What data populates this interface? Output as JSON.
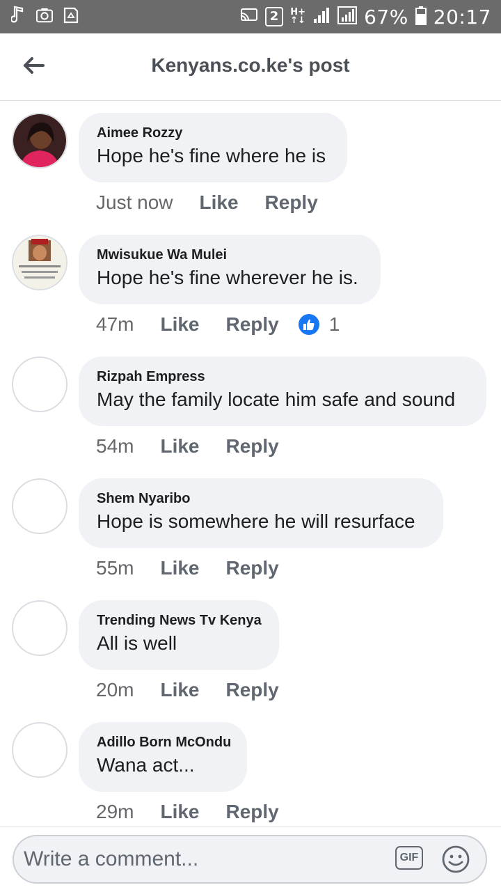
{
  "status_bar": {
    "sim_badge": "2",
    "network": "H+",
    "battery": "67%",
    "time": "20:17"
  },
  "header": {
    "title": "Kenyans.co.ke's post"
  },
  "comments": [
    {
      "author": "Aimee Rozzy",
      "text": "Hope he's fine where he is",
      "time": "Just now",
      "like_label": "Like",
      "reply_label": "Reply",
      "reactions": null
    },
    {
      "author": "Mwisukue Wa Mulei",
      "text": "Hope he's fine wherever he is.",
      "time": "47m",
      "like_label": "Like",
      "reply_label": "Reply",
      "reactions": "1"
    },
    {
      "author": "Rizpah Empress",
      "text": "May the family locate him safe and sound",
      "time": "54m",
      "like_label": "Like",
      "reply_label": "Reply",
      "reactions": null
    },
    {
      "author": "Shem Nyaribo",
      "text": "Hope is somewhere he will resurface",
      "time": "55m",
      "like_label": "Like",
      "reply_label": "Reply",
      "reactions": null
    },
    {
      "author": "Trending News Tv Kenya",
      "text": "All is well",
      "time": "20m",
      "like_label": "Like",
      "reply_label": "Reply",
      "reactions": null
    },
    {
      "author": "Adillo Born McOndu",
      "text": "Wana act...",
      "time": "29m",
      "like_label": "Like",
      "reply_label": "Reply",
      "reactions": null
    }
  ],
  "composer": {
    "placeholder": "Write a comment...",
    "gif_label": "GIF"
  },
  "colors": {
    "status_bar_bg": "#6b6b6b",
    "bubble_bg": "#f0f2f5",
    "like_blue": "#1877f2",
    "meta_text": "#65676b"
  },
  "icons": {
    "back": "arrow-left-icon",
    "like_reaction": "thumbs-up-icon",
    "emoji": "smiley-icon"
  }
}
